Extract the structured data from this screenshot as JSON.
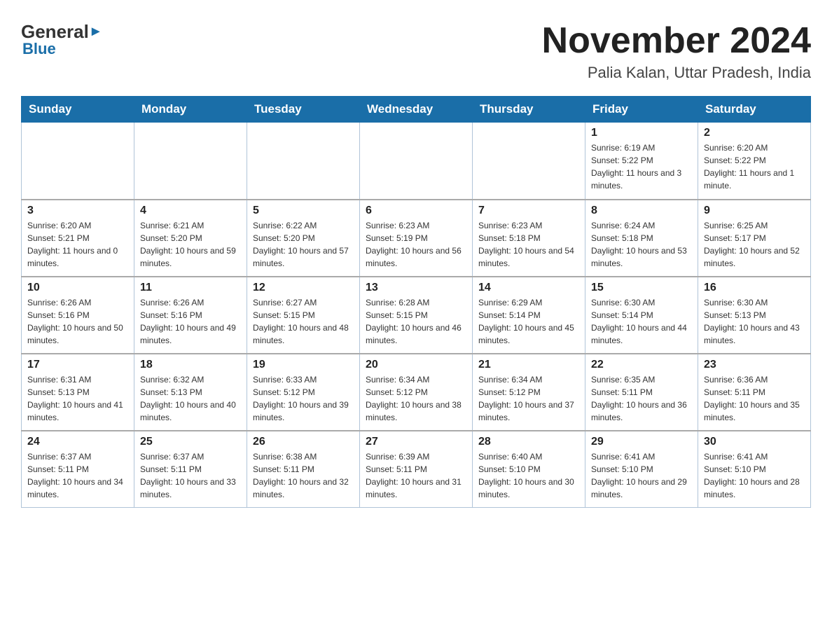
{
  "header": {
    "logo": {
      "general": "General",
      "blue": "Blue"
    },
    "title": "November 2024",
    "location": "Palia Kalan, Uttar Pradesh, India"
  },
  "weekdays": [
    "Sunday",
    "Monday",
    "Tuesday",
    "Wednesday",
    "Thursday",
    "Friday",
    "Saturday"
  ],
  "weeks": [
    [
      {
        "day": "",
        "info": ""
      },
      {
        "day": "",
        "info": ""
      },
      {
        "day": "",
        "info": ""
      },
      {
        "day": "",
        "info": ""
      },
      {
        "day": "",
        "info": ""
      },
      {
        "day": "1",
        "info": "Sunrise: 6:19 AM\nSunset: 5:22 PM\nDaylight: 11 hours and 3 minutes."
      },
      {
        "day": "2",
        "info": "Sunrise: 6:20 AM\nSunset: 5:22 PM\nDaylight: 11 hours and 1 minute."
      }
    ],
    [
      {
        "day": "3",
        "info": "Sunrise: 6:20 AM\nSunset: 5:21 PM\nDaylight: 11 hours and 0 minutes."
      },
      {
        "day": "4",
        "info": "Sunrise: 6:21 AM\nSunset: 5:20 PM\nDaylight: 10 hours and 59 minutes."
      },
      {
        "day": "5",
        "info": "Sunrise: 6:22 AM\nSunset: 5:20 PM\nDaylight: 10 hours and 57 minutes."
      },
      {
        "day": "6",
        "info": "Sunrise: 6:23 AM\nSunset: 5:19 PM\nDaylight: 10 hours and 56 minutes."
      },
      {
        "day": "7",
        "info": "Sunrise: 6:23 AM\nSunset: 5:18 PM\nDaylight: 10 hours and 54 minutes."
      },
      {
        "day": "8",
        "info": "Sunrise: 6:24 AM\nSunset: 5:18 PM\nDaylight: 10 hours and 53 minutes."
      },
      {
        "day": "9",
        "info": "Sunrise: 6:25 AM\nSunset: 5:17 PM\nDaylight: 10 hours and 52 minutes."
      }
    ],
    [
      {
        "day": "10",
        "info": "Sunrise: 6:26 AM\nSunset: 5:16 PM\nDaylight: 10 hours and 50 minutes."
      },
      {
        "day": "11",
        "info": "Sunrise: 6:26 AM\nSunset: 5:16 PM\nDaylight: 10 hours and 49 minutes."
      },
      {
        "day": "12",
        "info": "Sunrise: 6:27 AM\nSunset: 5:15 PM\nDaylight: 10 hours and 48 minutes."
      },
      {
        "day": "13",
        "info": "Sunrise: 6:28 AM\nSunset: 5:15 PM\nDaylight: 10 hours and 46 minutes."
      },
      {
        "day": "14",
        "info": "Sunrise: 6:29 AM\nSunset: 5:14 PM\nDaylight: 10 hours and 45 minutes."
      },
      {
        "day": "15",
        "info": "Sunrise: 6:30 AM\nSunset: 5:14 PM\nDaylight: 10 hours and 44 minutes."
      },
      {
        "day": "16",
        "info": "Sunrise: 6:30 AM\nSunset: 5:13 PM\nDaylight: 10 hours and 43 minutes."
      }
    ],
    [
      {
        "day": "17",
        "info": "Sunrise: 6:31 AM\nSunset: 5:13 PM\nDaylight: 10 hours and 41 minutes."
      },
      {
        "day": "18",
        "info": "Sunrise: 6:32 AM\nSunset: 5:13 PM\nDaylight: 10 hours and 40 minutes."
      },
      {
        "day": "19",
        "info": "Sunrise: 6:33 AM\nSunset: 5:12 PM\nDaylight: 10 hours and 39 minutes."
      },
      {
        "day": "20",
        "info": "Sunrise: 6:34 AM\nSunset: 5:12 PM\nDaylight: 10 hours and 38 minutes."
      },
      {
        "day": "21",
        "info": "Sunrise: 6:34 AM\nSunset: 5:12 PM\nDaylight: 10 hours and 37 minutes."
      },
      {
        "day": "22",
        "info": "Sunrise: 6:35 AM\nSunset: 5:11 PM\nDaylight: 10 hours and 36 minutes."
      },
      {
        "day": "23",
        "info": "Sunrise: 6:36 AM\nSunset: 5:11 PM\nDaylight: 10 hours and 35 minutes."
      }
    ],
    [
      {
        "day": "24",
        "info": "Sunrise: 6:37 AM\nSunset: 5:11 PM\nDaylight: 10 hours and 34 minutes."
      },
      {
        "day": "25",
        "info": "Sunrise: 6:37 AM\nSunset: 5:11 PM\nDaylight: 10 hours and 33 minutes."
      },
      {
        "day": "26",
        "info": "Sunrise: 6:38 AM\nSunset: 5:11 PM\nDaylight: 10 hours and 32 minutes."
      },
      {
        "day": "27",
        "info": "Sunrise: 6:39 AM\nSunset: 5:11 PM\nDaylight: 10 hours and 31 minutes."
      },
      {
        "day": "28",
        "info": "Sunrise: 6:40 AM\nSunset: 5:10 PM\nDaylight: 10 hours and 30 minutes."
      },
      {
        "day": "29",
        "info": "Sunrise: 6:41 AM\nSunset: 5:10 PM\nDaylight: 10 hours and 29 minutes."
      },
      {
        "day": "30",
        "info": "Sunrise: 6:41 AM\nSunset: 5:10 PM\nDaylight: 10 hours and 28 minutes."
      }
    ]
  ]
}
